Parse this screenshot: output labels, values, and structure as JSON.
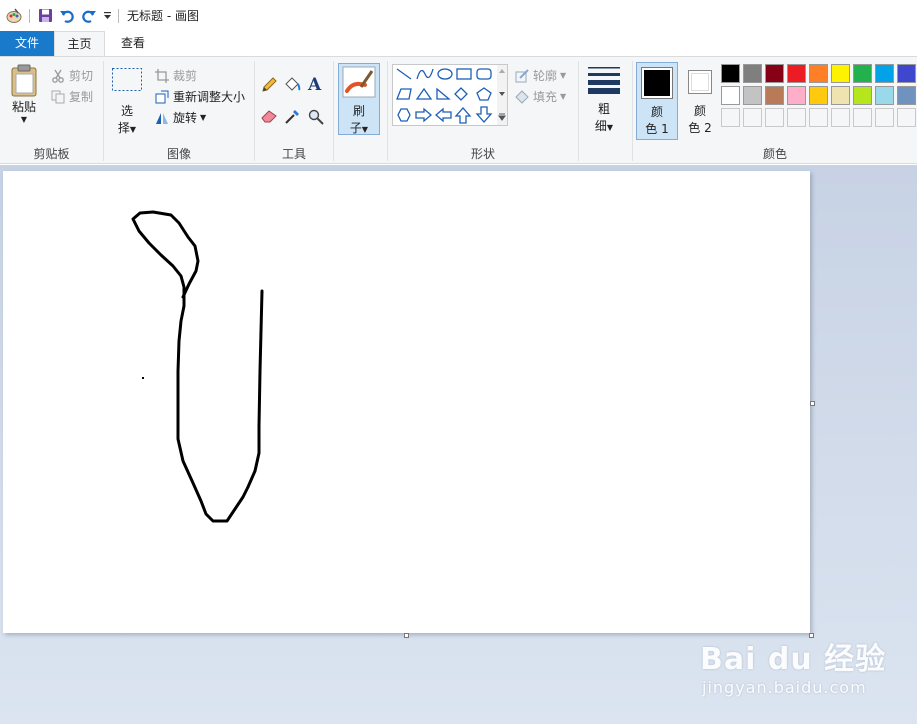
{
  "window": {
    "title": "无标题 - 画图"
  },
  "quick_access": {
    "icons": [
      "paint-app-icon",
      "save-icon",
      "undo-icon",
      "redo-icon",
      "customize-dropdown-icon"
    ]
  },
  "tabs": [
    {
      "label": "文件",
      "active": false
    },
    {
      "label": "主页",
      "active": true
    },
    {
      "label": "查看",
      "active": false
    }
  ],
  "ribbon": {
    "clipboard": {
      "group_label": "剪贴板",
      "paste_label": "粘贴",
      "cut_label": "剪切",
      "copy_label": "复制"
    },
    "image": {
      "group_label": "图像",
      "select_label_1": "选",
      "select_label_2": "择",
      "crop_label": "裁剪",
      "resize_label": "重新调整大小",
      "rotate_label": "旋转"
    },
    "tools": {
      "group_label": "工具",
      "icons": [
        "pencil-icon",
        "fill-bucket-icon",
        "text-icon",
        "eraser-icon",
        "color-picker-icon",
        "magnifier-icon"
      ]
    },
    "brushes": {
      "label_1": "刷",
      "label_2": "子"
    },
    "shapes": {
      "group_label": "形状",
      "outline_label": "轮廓",
      "fill_label": "填充"
    },
    "size": {
      "label_1": "粗",
      "label_2": "细"
    },
    "colors": {
      "group_label": "颜色",
      "color1_label_1": "颜",
      "color1_label_2": "色 1",
      "color2_label_1": "颜",
      "color2_label_2": "色 2",
      "color1_value": "#000000",
      "color2_value": "#ffffff",
      "palette_row1": [
        "#000000",
        "#7f7f7f",
        "#880015",
        "#ed1c24",
        "#ff7f27",
        "#fff200",
        "#22b14c",
        "#00a2e8",
        "#3f48cc",
        "#a349a4"
      ],
      "palette_row2": [
        "#ffffff",
        "#c3c3c3",
        "#b97a57",
        "#ffaec9",
        "#ffc90e",
        "#efe4b0",
        "#b5e61d",
        "#99d9ea",
        "#7092be",
        "#c8bfe7"
      ]
    }
  },
  "watermark": {
    "brand": "Bai du 经验",
    "url": "jingyan.baidu.com"
  }
}
